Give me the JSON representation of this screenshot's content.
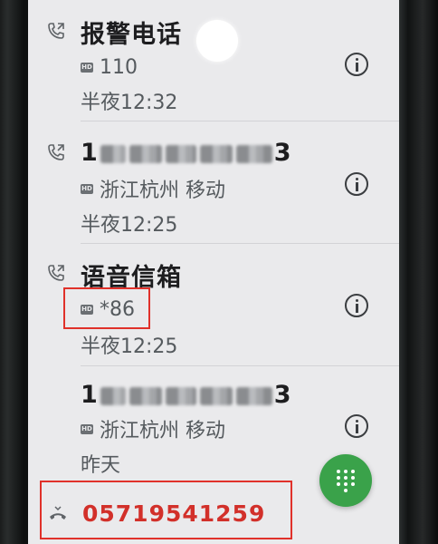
{
  "call_log": [
    {
      "name": "报警电话",
      "hd": "HD",
      "detail": "110",
      "time": "半夜12:32"
    },
    {
      "number_prefix": "1",
      "number_suffix": "3",
      "hd": "HD",
      "detail": "浙江杭州 移动",
      "time": "半夜12:25"
    },
    {
      "name": "语音信箱",
      "hd": "HD",
      "detail": "*86",
      "time": "半夜12:25"
    },
    {
      "number_prefix": "1",
      "number_suffix": "3",
      "hd": "HD",
      "detail": "浙江杭州 移动",
      "time": "昨天"
    }
  ],
  "missed_call": {
    "number": "05719541259"
  },
  "colors": {
    "highlight_red": "#e0312a",
    "missed_red": "#d2302a",
    "fab_green": "#3aa24a"
  },
  "icons": {
    "call_type": "call-outgoing-icon",
    "info": "info-icon",
    "dialpad": "dialpad-icon",
    "missed": "missed-call-icon"
  }
}
